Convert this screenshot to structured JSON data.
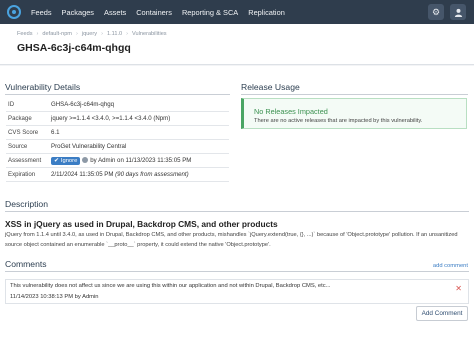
{
  "nav": {
    "items": [
      "Feeds",
      "Packages",
      "Assets",
      "Containers",
      "Reporting & SCA",
      "Replication"
    ],
    "icons": [
      "gear-icon",
      "user-icon"
    ]
  },
  "header": {
    "breadcrumbs": [
      "Feeds",
      "default-npm",
      "jquery",
      "1.11.0",
      "Vulnerabilities"
    ],
    "title": "GHSA-6c3j-c64m-qhgq"
  },
  "details": {
    "title": "Vulnerability Details",
    "rows": [
      {
        "key": "ID",
        "value": "GHSA-6c3j-c64m-qhgq"
      },
      {
        "key": "Package",
        "value": "jquery >=1.1.4 <3.4.0, >=1.1.4 <3.4.0 (Npm)"
      },
      {
        "key": "CVS Score",
        "value": "6.1"
      },
      {
        "key": "Source",
        "value": "ProGet Vulnerability Central"
      },
      {
        "key": "Assessment",
        "badge": "Ignore",
        "value": "by Admin on 11/13/2023 11:35:05 PM"
      },
      {
        "key": "Expiration",
        "value": "2/11/2024 11:35:05 PM",
        "note": "(90 days from assessment)"
      }
    ]
  },
  "release": {
    "title": "Release Usage",
    "box_title": "No Releases Impacted",
    "box_text": "There are no active releases that are impacted by this vulnerability."
  },
  "description": {
    "title": "Description",
    "heading": "XSS in jQuery as used in Drupal, Backdrop CMS, and other products",
    "text": "jQuery from 1.1.4 until 3.4.0, as used in Drupal, Backdrop CMS, and other products, mishandles `jQuery.extend(true, {}, ...)` because of 'Object.prototype' pollution. If an unsanitized source object contained an enumerable `__proto__` property, it could extend the native 'Object.prototype'."
  },
  "comments": {
    "title": "Comments",
    "add_link": "add comment",
    "items": [
      {
        "text": "This vulnerability does not affect us since we are using this within our application and not within Drupal, Backdrop CMS, etc...",
        "meta": "11/14/2023 10:38:13 PM by Admin"
      }
    ],
    "add_button": "Add Comment"
  },
  "colors": {
    "nav_bg": "#2f3d4d",
    "accent": "#3b7dc4",
    "success": "#4aa564",
    "danger": "#d9534f"
  }
}
